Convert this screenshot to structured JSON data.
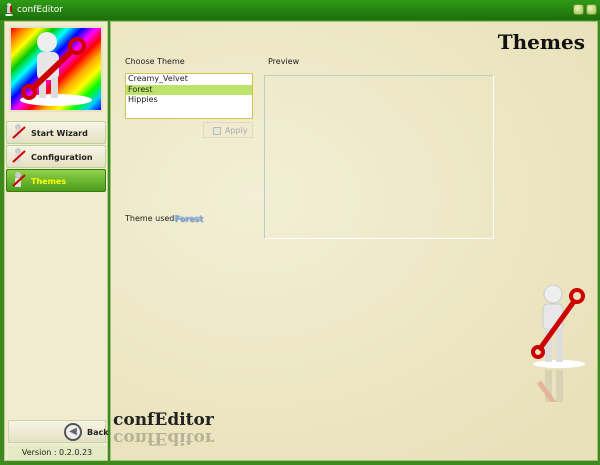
{
  "window": {
    "title": "confEditor"
  },
  "sidebar": {
    "items": [
      {
        "label": "Start Wizard",
        "active": false
      },
      {
        "label": "Configuration",
        "active": false
      },
      {
        "label": "Themes",
        "active": true
      }
    ],
    "back_label": "Back",
    "version": "Version : 0.2.0.23"
  },
  "main": {
    "heading": "Themes",
    "choose_label": "Choose Theme",
    "themes": [
      "Creamy_Velvet",
      "Forest",
      "Hippies"
    ],
    "selected_theme": "Forest",
    "apply_label": "Apply",
    "preview_label": "Preview",
    "theme_used_label": "Theme used",
    "theme_used_value": "Forest",
    "brand": "confEditor"
  },
  "colors": {
    "accent": "#4b9c1a",
    "selection": "#bde36a",
    "active_text": "#ffff00"
  }
}
